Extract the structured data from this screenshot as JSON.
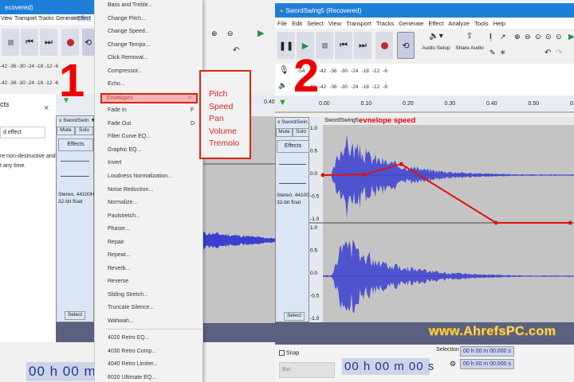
{
  "left_window": {
    "title": "ecovered)",
    "menu": [
      "View",
      "Transport",
      "Tracks",
      "Generate",
      "Effect"
    ],
    "meter_ticks": [
      "-42",
      "-36",
      "-30",
      "-24",
      "-18",
      "-12",
      "-6"
    ],
    "effects_panel": {
      "title": "cts",
      "input": "d effect",
      "text1": "re non-destructive and",
      "text2": "t any time."
    },
    "track": {
      "name": "SwordSwin",
      "mute": "Mute",
      "solo": "Solo",
      "effects": "Effects",
      "info1": "Stereo, 44100Hz",
      "info2": "32-bit float",
      "select": "Select"
    },
    "ruler_label": "0.40",
    "timer": "00 h 00 m 0"
  },
  "effect_menu": {
    "items": [
      {
        "label": "Bass and Treble..."
      },
      {
        "label": "Change Pitch..."
      },
      {
        "label": "Change Speed..."
      },
      {
        "label": "Change Tempo..."
      },
      {
        "label": "Click Removal..."
      },
      {
        "label": "Compressor..."
      },
      {
        "label": "Echo..."
      },
      {
        "label": "Envelopes",
        "shortcut": ">"
      },
      {
        "label": "Fade In",
        "shortcut": "F"
      },
      {
        "label": "Fade Out",
        "shortcut": "D"
      },
      {
        "label": "Filter Curve EQ..."
      },
      {
        "label": "Graphic EQ..."
      },
      {
        "label": "Invert"
      },
      {
        "label": "Loudness Normalization..."
      },
      {
        "label": "Noise Reduction..."
      },
      {
        "label": "Normalize..."
      },
      {
        "label": "Paulstretch..."
      },
      {
        "label": "Phaser..."
      },
      {
        "label": "Repair"
      },
      {
        "label": "Repeat..."
      },
      {
        "label": "Reverb..."
      },
      {
        "label": "Reverse"
      },
      {
        "label": "Sliding Stretch..."
      },
      {
        "label": "Truncate Silence..."
      },
      {
        "label": "Wahwah..."
      }
    ],
    "plugins": [
      "4020 Retro EQ...",
      "4030 Retro Comp...",
      "4040 Retro Limiter...",
      "6020 Ultimate EQ..."
    ],
    "highlighted": "Envelopes",
    "submenu": [
      "Pitch",
      "Speed",
      "Pan",
      "Volume",
      "Tremolo"
    ]
  },
  "annotations": {
    "step1": "1",
    "step2": "2",
    "envelope_caption": "evnelope speed",
    "watermark": "www.AhrefsPC.com"
  },
  "right_window": {
    "title": "SwordSwing5 (Recovered)",
    "menu": [
      "File",
      "Edit",
      "Select",
      "View",
      "Transport",
      "Tracks",
      "Generate",
      "Effect",
      "Analyze",
      "Tools",
      "Help"
    ],
    "audio_setup": "Audio Setup",
    "share_audio": "Share Audio",
    "meter_ticks": [
      "-54",
      "-48",
      "-42",
      "-36",
      "-30",
      "-24",
      "-18",
      "-12",
      "-6"
    ],
    "ruler": [
      "0.00",
      "0.10",
      "0.20",
      "0.30",
      "0.40",
      "0.50",
      "0.60"
    ],
    "track": {
      "name": "SwordSwin",
      "clip": "SwordSwing5",
      "mute": "Mute",
      "solo": "Solo",
      "effects": "Effects",
      "info1": "Stereo, 44100Hz",
      "info2": "32-bit float",
      "select": "Select"
    },
    "scale": [
      "1.0",
      "0.5",
      "0.0",
      "-0.5",
      "-1.0"
    ],
    "envelope_points": [
      [
        0.0,
        0.0
      ],
      [
        0.1,
        0.01
      ],
      [
        0.19,
        0.23
      ],
      [
        0.42,
        -1.0
      ],
      [
        0.6,
        -1.0
      ]
    ],
    "snap": "Snap",
    "snap_unit": "Bar",
    "timer": "00 h 00 m 00 s",
    "selection_label": "Selection",
    "sel_start": "00 h 00 m 00.000 s",
    "sel_end": "00 h 00 m 00.000 s"
  },
  "colors": {
    "accent": "#1e7fd8",
    "waveform": "#3b3fd0",
    "envelope": "#e01010",
    "annotation": "#e00000"
  }
}
